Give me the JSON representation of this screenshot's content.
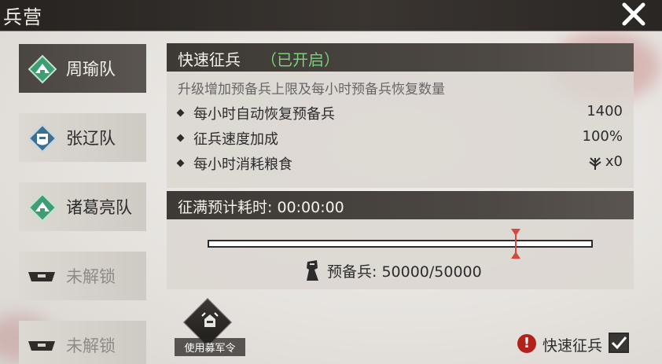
{
  "header": {
    "title": "兵营"
  },
  "teams": [
    {
      "label": "周瑜队",
      "state": "active",
      "badge": "tent-badge-green"
    },
    {
      "label": "张辽队",
      "state": "normal",
      "badge": "helmet-badge-blue"
    },
    {
      "label": "诸葛亮队",
      "state": "normal",
      "badge": "tent-badge-green"
    },
    {
      "label": "未解锁",
      "state": "locked",
      "badge": "lock-icon"
    },
    {
      "label": "未解锁",
      "state": "locked",
      "badge": "lock-icon"
    }
  ],
  "quick_conscription": {
    "title": "快速征兵",
    "status": "（已开启）",
    "description": "升级增加预备兵上限及每小时预备兵恢复数量",
    "rows": [
      {
        "label": "每小时自动恢复预备兵",
        "value": "1400"
      },
      {
        "label": "征兵速度加成",
        "value": "100%"
      },
      {
        "label": "每小时消耗粮食",
        "value": "x0",
        "icon": "grain-icon"
      }
    ]
  },
  "progress": {
    "time_label": "征满预计耗时: 00:00:00",
    "fraction": 1.0,
    "marker_fraction": 0.8,
    "reserve_label": "预备兵: 50000/50000"
  },
  "bottom": {
    "use_order_label": "使用募军令",
    "quick_label": "快速征兵",
    "quick_checked": true
  },
  "colors": {
    "status_green": "#7bd07a",
    "warning_red": "#b3211b",
    "marker_red": "#d8473e"
  }
}
